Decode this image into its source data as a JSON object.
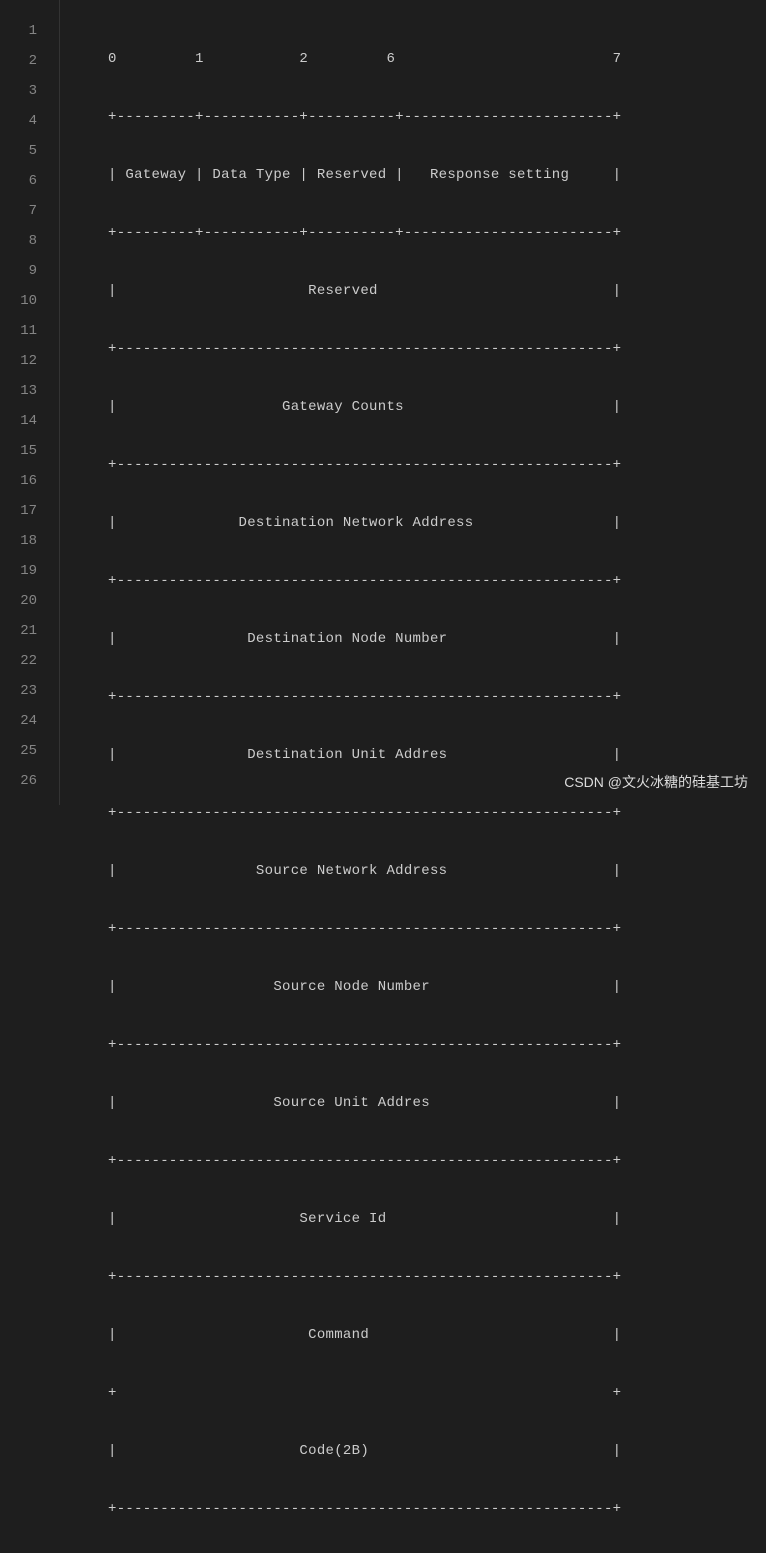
{
  "lines": [
    "0         1           2         6                         7",
    "+---------+-----------+----------+------------------------+",
    "| Gateway | Data Type | Reserved |   Response setting     |",
    "+---------+-----------+----------+------------------------+",
    "|                      Reserved                           |",
    "+---------------------------------------------------------+",
    "|                   Gateway Counts                        |",
    "+---------------------------------------------------------+",
    "|              Destination Network Address                |",
    "+---------------------------------------------------------+",
    "|               Destination Node Number                   |",
    "+---------------------------------------------------------+",
    "|               Destination Unit Addres                   |",
    "+---------------------------------------------------------+",
    "|                Source Network Address                   |",
    "+---------------------------------------------------------+",
    "|                  Source Node Number                     |",
    "+---------------------------------------------------------+",
    "|                  Source Unit Addres                     |",
    "+---------------------------------------------------------+",
    "|                     Service Id                          |",
    "+---------------------------------------------------------+",
    "|                      Command                            |",
    "+                                                         +",
    "|                     Code(2B)                            |",
    "+---------------------------------------------------------+"
  ],
  "lineNumbers": [
    "1",
    "2",
    "3",
    "4",
    "5",
    "6",
    "7",
    "8",
    "9",
    "10",
    "11",
    "12",
    "13",
    "14",
    "15",
    "16",
    "17",
    "18",
    "19",
    "20",
    "21",
    "22",
    "23",
    "24",
    "25",
    "26"
  ],
  "watermark": "CSDN @文火冰糖的硅基工坊"
}
